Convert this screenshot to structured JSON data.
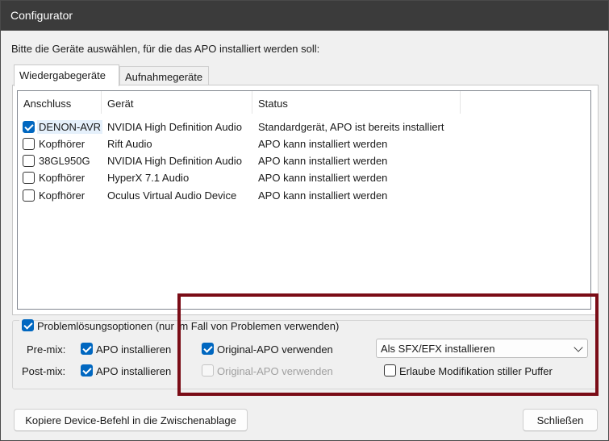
{
  "window": {
    "title": "Configurator"
  },
  "prompt": "Bitte die Geräte auswählen, für die das APO installiert werden soll:",
  "tabs": [
    {
      "label": "Wiedergabegeräte",
      "active": true
    },
    {
      "label": "Aufnahmegeräte",
      "active": false
    }
  ],
  "columns": [
    "Anschluss",
    "Gerät",
    "Status"
  ],
  "devices": [
    {
      "connection": "DENON-AVR",
      "device": "NVIDIA High Definition Audio",
      "status": "Standardgerät, APO ist bereits installiert",
      "checked": true
    },
    {
      "connection": "Kopfhörer",
      "device": "Rift Audio",
      "status": "APO kann installiert werden",
      "checked": false
    },
    {
      "connection": "38GL950G",
      "device": "NVIDIA High Definition Audio",
      "status": "APO kann installiert werden",
      "checked": false
    },
    {
      "connection": "Kopfhörer",
      "device": "HyperX 7.1 Audio",
      "status": "APO kann installiert werden",
      "checked": false
    },
    {
      "connection": "Kopfhörer",
      "device": "Oculus Virtual Audio Device",
      "status": "APO kann installiert werden",
      "checked": false
    }
  ],
  "troubleshooting": {
    "label": "Problemlösungsoptionen (nur im Fall von Problemen verwenden)",
    "checked": true,
    "premix_label": "Pre-mix:",
    "postmix_label": "Post-mix:",
    "install_apo_label": "APO installieren",
    "original_apo_label": "Original-APO verwenden",
    "install_mode": "Als SFX/EFX installieren",
    "silent_buffer_label": "Erlaube Modifikation stiller Puffer"
  },
  "buttons": {
    "copy": "Kopiere Device-Befehl in die Zwischenablage",
    "close": "Schließen"
  },
  "colors": {
    "accent": "#0067c0",
    "titlebar": "#3b3b3b",
    "highlight_box": "#7a0c16"
  }
}
